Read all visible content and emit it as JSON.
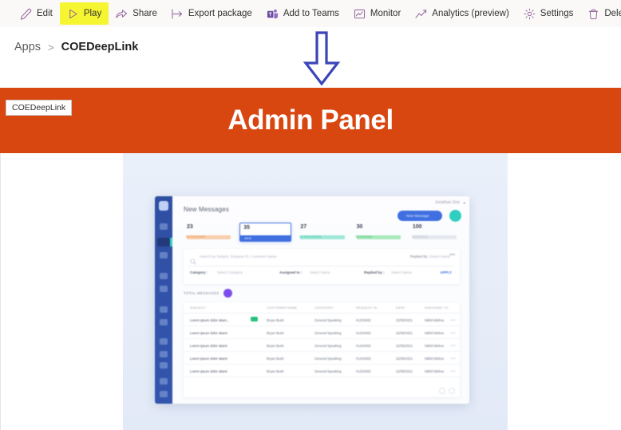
{
  "commandbar": {
    "items": [
      {
        "label": "Edit",
        "icon": "pencil-icon"
      },
      {
        "label": "Play",
        "icon": "play-icon",
        "highlighted": true
      },
      {
        "label": "Share",
        "icon": "share-icon"
      },
      {
        "label": "Export package",
        "icon": "export-icon"
      },
      {
        "label": "Add to Teams",
        "icon": "teams-icon"
      },
      {
        "label": "Monitor",
        "icon": "monitor-icon"
      },
      {
        "label": "Analytics (preview)",
        "icon": "analytics-icon"
      },
      {
        "label": "Settings",
        "icon": "gear-icon"
      },
      {
        "label": "Delete",
        "icon": "trash-icon"
      }
    ],
    "highlight_color": "#f6f531"
  },
  "breadcrumb": {
    "root": "Apps",
    "separator": ">",
    "current": "COEDeepLink"
  },
  "annotation": {
    "shape": "down-arrow",
    "color": "#3b45b8"
  },
  "banner": {
    "logo_label": "COEDeepLink",
    "title": "Admin Panel",
    "background_color": "#d94711",
    "title_color": "#ffffff"
  },
  "app_preview": {
    "header": {
      "title": "New Messages",
      "user_name": "Jonathan Doe",
      "caret": "▾",
      "new_button": "New Message"
    },
    "stats": [
      {
        "value": "23",
        "label": "WITHDRAWN",
        "color": "#f08a3c",
        "active": false
      },
      {
        "value": "35",
        "label": "NEW",
        "color": "#3f6fe0",
        "active": true
      },
      {
        "value": "27",
        "label": "IN PROGRESS",
        "color": "#62dcc0",
        "active": false
      },
      {
        "value": "30",
        "label": "RESOLVED",
        "color": "#5fd98a",
        "active": false
      },
      {
        "value": "100",
        "label": "ASSIGNED",
        "color": "#e5e8ef",
        "active": false
      }
    ],
    "search": {
      "placeholder": "Search by Subject, Request ID, Customer Name",
      "replied_by_label": "Replied By :",
      "replied_by_value": "Select Name",
      "more_icon": "more-icon"
    },
    "filters": [
      {
        "label": "Category :",
        "value": "Select Category"
      },
      {
        "label": "Assigned to :",
        "value": "Select Name"
      },
      {
        "label": "Replied by :",
        "value": "Select Name"
      }
    ],
    "apply_label": "APPLY",
    "totals_label": "TOTAL MESSAGES",
    "totals_value": "100",
    "table": {
      "columns": [
        "SUBJECT",
        "CUSTOMER NAME",
        "CATEGORY",
        "REQUEST ID",
        "DATE",
        "ASSIGNED TO"
      ],
      "rows": [
        {
          "subject": "Lorem ipsum dolor sitam...",
          "badge": "NEW",
          "customer": "Bryan Bush",
          "category": "General Speaking",
          "request_id": "#1203453",
          "date": "22/05/2021",
          "assigned": "Nikhil Mishra"
        },
        {
          "subject": "Lorem ipsum dolor sitami",
          "badge": "",
          "customer": "Bryan Bush",
          "category": "General Speaking",
          "request_id": "#1203453",
          "date": "22/05/2021",
          "assigned": "Nikhil Mishra"
        },
        {
          "subject": "Lorem ipsum dolor sitami",
          "badge": "",
          "customer": "Bryan Bush",
          "category": "General Speaking",
          "request_id": "#1203453",
          "date": "22/05/2021",
          "assigned": "Nikhil Mishra"
        },
        {
          "subject": "Lorem ipsum dolor sitami",
          "badge": "",
          "customer": "Bryan Bush",
          "category": "General Speaking",
          "request_id": "#1203453",
          "date": "22/05/2021",
          "assigned": "Nikhil Mishra"
        },
        {
          "subject": "Lorem ipsum dolor sitami",
          "badge": "",
          "customer": "Bryan Bush",
          "category": "General Speaking",
          "request_id": "#1203453",
          "date": "22/05/2021",
          "assigned": "Nikhil Mishra"
        }
      ],
      "row_menu_icon": "kebab-icon"
    },
    "pagination": {
      "prev": "prev-page-icon",
      "next": "next-page-icon"
    }
  }
}
